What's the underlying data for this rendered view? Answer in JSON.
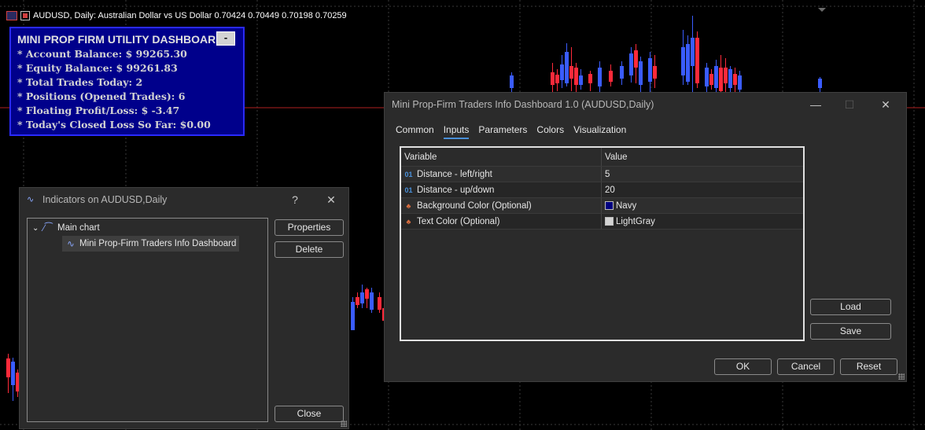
{
  "chart": {
    "header_text": "AUDUSD, Daily:  Australian Dollar vs US Dollar  0.70424 0.70449 0.70198 0.70259",
    "bull_color": "#3a5cff",
    "bear_color": "#ff2a3a",
    "level_line_color": "#b02020"
  },
  "dashboard": {
    "title": "MINI PROP FIRM UTILITY DASHBOARD",
    "minimize_label": "-",
    "lines": [
      "* Account Balance: $ 99265.30",
      "* Equity Balance: $ 99261.83",
      "* Total Trades Today: 2",
      "* Positions (Opened Trades): 6",
      "* Floating Profit/Loss: $ -3.47",
      "* Today's Closed Loss So Far: $0.00"
    ],
    "background_color": "#00008b",
    "text_color": "#d3d3d3"
  },
  "indicators_dialog": {
    "title": "Indicators on AUDUSD,Daily",
    "help_label": "?",
    "close_icon": "✕",
    "tree": {
      "root_label": "Main chart",
      "child_label": "Mini Prop-Firm Traders Info Dashboard"
    },
    "buttons": {
      "properties": "Properties",
      "delete": "Delete",
      "close": "Close"
    }
  },
  "main_dialog": {
    "title": "Mini Prop-Firm Traders Info Dashboard 1.0 (AUDUSD,Daily)",
    "tabs": [
      "Common",
      "Inputs",
      "Parameters",
      "Colors",
      "Visualization"
    ],
    "active_tab": "Inputs",
    "table": {
      "headers": [
        "Variable",
        "Value"
      ],
      "rows": [
        {
          "icon": "01",
          "variable": "Distance - left/right",
          "value": "5"
        },
        {
          "icon": "01",
          "variable": "Distance - up/down",
          "value": "20"
        },
        {
          "icon": "color",
          "variable": "Background Color (Optional)",
          "value": "Navy",
          "swatch": "#000080"
        },
        {
          "icon": "color",
          "variable": "Text Color (Optional)",
          "value": "LightGray",
          "swatch": "#d3d3d3"
        }
      ]
    },
    "side_buttons": {
      "load": "Load",
      "save": "Save"
    },
    "footer_buttons": {
      "ok": "OK",
      "cancel": "Cancel",
      "reset": "Reset"
    }
  }
}
